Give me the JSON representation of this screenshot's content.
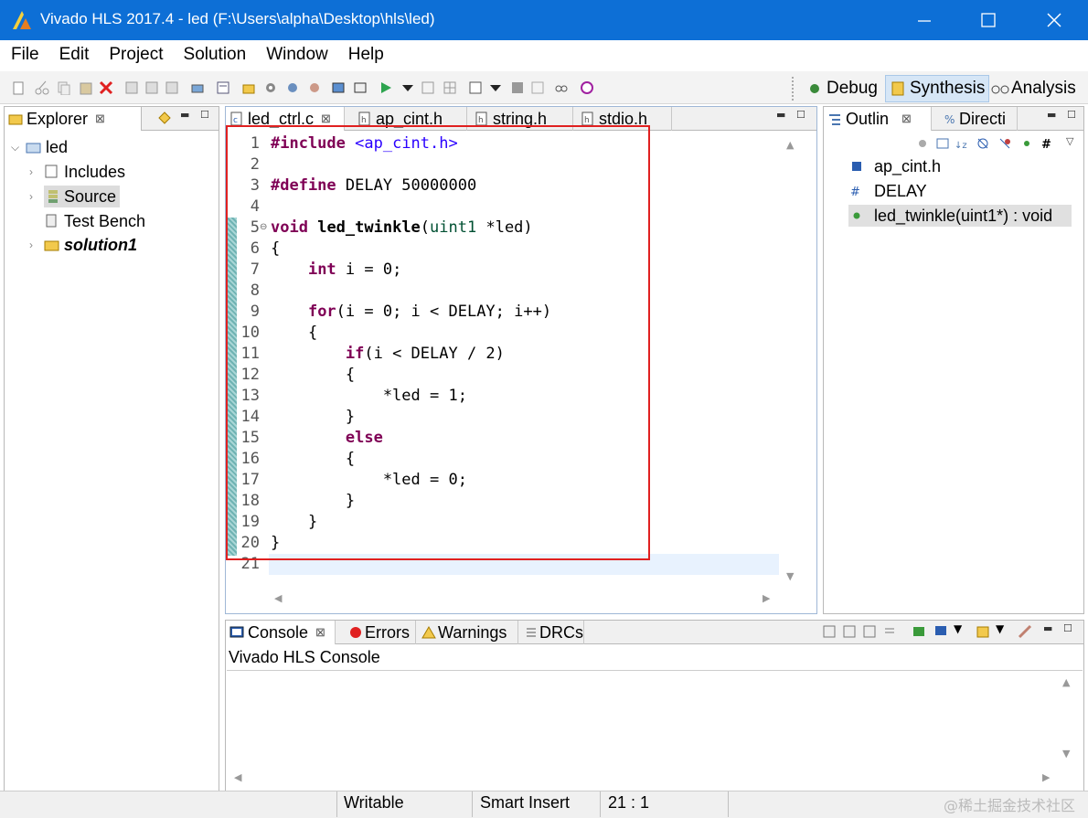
{
  "window": {
    "title": "Vivado HLS 2017.4 - led (F:\\Users\\alpha\\Desktop\\hls\\led)"
  },
  "menu": [
    "File",
    "Edit",
    "Project",
    "Solution",
    "Window",
    "Help"
  ],
  "perspectives": {
    "debug": "Debug",
    "synthesis": "Synthesis",
    "analysis": "Analysis"
  },
  "explorer": {
    "tab": "Explorer",
    "root": "led",
    "items": [
      "Includes",
      "Source",
      "Test Bench",
      "solution1"
    ]
  },
  "editor": {
    "tabs": [
      "led_ctrl.c",
      "ap_cint.h",
      "string.h",
      "stdio.h"
    ],
    "cursor_line": 21
  },
  "outline": {
    "tabs": [
      "Outlin",
      "Directi"
    ],
    "items": [
      "ap_cint.h",
      "DELAY",
      "led_twinkle(uint1*) : void"
    ]
  },
  "console": {
    "tabs": [
      "Console",
      "Errors",
      "Warnings",
      "DRCs"
    ],
    "title": "Vivado HLS Console"
  },
  "status": {
    "mode": "Writable",
    "insert": "Smart Insert",
    "position": "21 : 1"
  },
  "watermark": "@稀土掘金技术社区",
  "colors": {
    "titlebar": "#0d6fd6",
    "highlight_box": "#e02020",
    "keyword": "#7f0055",
    "string": "#2a00ff"
  }
}
